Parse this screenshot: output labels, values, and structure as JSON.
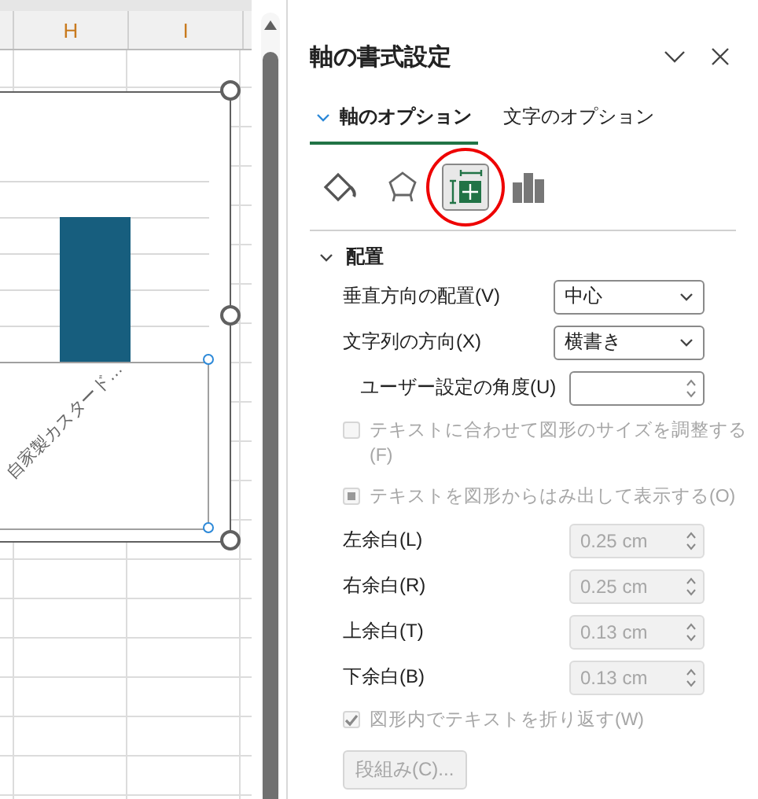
{
  "sheet": {
    "columns": [
      {
        "label": "H"
      },
      {
        "label": "I"
      }
    ]
  },
  "chart": {
    "axis_label": "自家製カスタード…"
  },
  "panel": {
    "title": "軸の書式設定",
    "tabs": [
      {
        "label": "軸のオプション",
        "selected": true
      },
      {
        "label": "文字のオプション",
        "selected": false
      }
    ],
    "icons": [
      {
        "kind": "fill",
        "selected": false
      },
      {
        "kind": "effects",
        "selected": false
      },
      {
        "kind": "size",
        "selected": true,
        "circled": true
      },
      {
        "kind": "axis",
        "selected": false
      }
    ],
    "section": {
      "title": "配置",
      "expanded": true,
      "rows": [
        {
          "kind": "select",
          "label": "垂直方向の配置(V)",
          "value": "中心",
          "disabled": false
        },
        {
          "kind": "select",
          "label": "文字列の方向(X)",
          "value": "横書き",
          "disabled": false,
          "children": [
            {
              "kind": "spinner",
              "label": "ユーザー設定の角度(U)",
              "disabled": false
            }
          ]
        },
        {
          "kind": "checkbox",
          "label": "テキストに合わせて図形のサイズを調整する(F)",
          "checked": false,
          "disabled": true
        },
        {
          "kind": "checkbox",
          "label": "テキストを図形からはみ出して表示する(O)",
          "indeterminate": true,
          "disabled": true
        },
        {
          "kind": "spinner",
          "label": "左余白(L)",
          "value": "0.25 cm",
          "disabled": true
        },
        {
          "kind": "spinner",
          "label": "右余白(R)",
          "value": "0.25 cm",
          "disabled": true
        },
        {
          "kind": "spinner",
          "label": "上余白(T)",
          "value": "0.13 cm",
          "disabled": true
        },
        {
          "kind": "spinner",
          "label": "下余白(B)",
          "value": "0.13 cm",
          "disabled": true
        },
        {
          "kind": "checkbox",
          "label": "図形内でテキストを折り返す(W)",
          "checked": true,
          "disabled": true
        },
        {
          "kind": "button",
          "label": "段組み(C)...",
          "disabled": true
        }
      ]
    }
  }
}
